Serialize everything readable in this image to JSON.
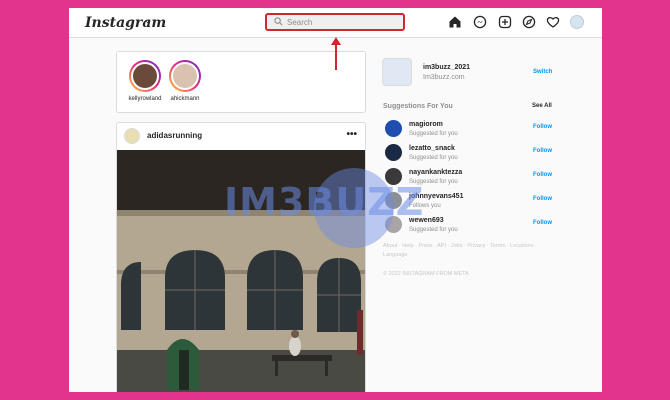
{
  "header": {
    "logo": "Instagram",
    "search_placeholder": "Search"
  },
  "stories": [
    {
      "name": "kellyrowland"
    },
    {
      "name": "ahickmann"
    }
  ],
  "post": {
    "username": "adidasrunning",
    "more": "•••"
  },
  "watermark": "IM3BUZZ",
  "current_user": {
    "username": "im3buzz_2021",
    "name": "Im3buzz.com",
    "switch_label": "Switch"
  },
  "suggestions": {
    "title": "Suggestions For You",
    "see_all": "See All",
    "follow_label": "Follow",
    "items": [
      {
        "username": "magiorom",
        "sub": "Suggested for you"
      },
      {
        "username": "lezatto_snack",
        "sub": "Suggested for you"
      },
      {
        "username": "nayankanktezza",
        "sub": "Suggested for you"
      },
      {
        "username": "johnnyevans451",
        "sub": "Follows you"
      },
      {
        "username": "wewen693",
        "sub": "Suggested for you"
      }
    ]
  },
  "footer": {
    "links": "About · Help · Press · API · Jobs · Privacy · Terms · Locations · Language",
    "copyright": "© 2022 INSTAGRAM FROM META"
  },
  "colors": {
    "background": "#e3348d",
    "accent": "#0095f6",
    "highlight": "#d0262f"
  }
}
